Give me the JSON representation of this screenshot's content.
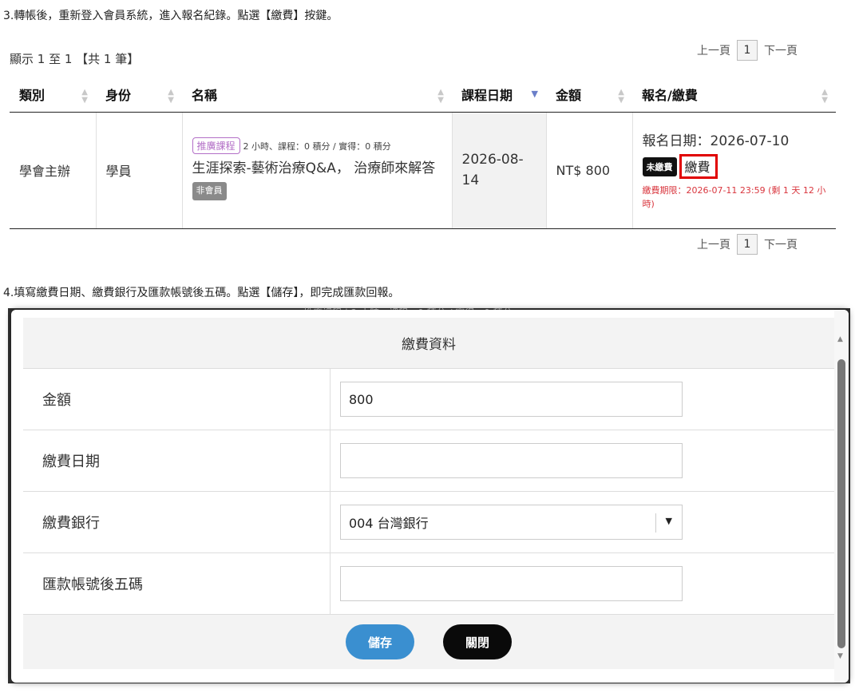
{
  "instructions": {
    "step3": "3.轉帳後，重新登入會員系統，進入報名紀錄。點選【繳費】按鍵。",
    "step4": "4.填寫繳費日期、繳費銀行及匯款帳號後五碼。點選【儲存】，即完成匯款回報。"
  },
  "list": {
    "summary": "顯示 1 至 1 【共 1 筆】",
    "pager": {
      "prev": "上一頁",
      "page": "1",
      "next": "下一頁"
    },
    "headers": {
      "category": "類別",
      "identity": "身份",
      "name": "名稱",
      "course_date": "課程日期",
      "amount": "金額",
      "reg_pay": "報名/繳費"
    },
    "row": {
      "category": "學會主辦",
      "identity": "學員",
      "promo_tag": "推廣課程",
      "course_meta": "2 小時、課程：0 積分 / 實得：0 積分",
      "course_name": "生涯探索-藝術治療Q&A， 治療師來解答",
      "nonmember_tag": "非會員",
      "course_date": "2026-08-14",
      "amount": "NT$ 800",
      "reg_date": "報名日期：2026-07-10",
      "unpaid_badge": "未繳費",
      "pay_link": "繳費",
      "deadline": "繳費期限：2026-07-11 23:59 (剩 1 天 12 小時)"
    }
  },
  "modal": {
    "peek_text": "推廣課程 | 2 小時、課程：0 積分 / 實得：0 積分",
    "title": "繳費資料",
    "fields": {
      "amount_label": "金額",
      "amount_value": "800",
      "date_label": "繳費日期",
      "date_value": "",
      "bank_label": "繳費銀行",
      "bank_value": "004 台灣銀行",
      "account_label": "匯款帳號後五碼",
      "account_value": ""
    },
    "buttons": {
      "save": "儲存",
      "close": "關閉"
    }
  },
  "colors": {
    "save_button": "#3a8fd0",
    "close_button": "#0a0a0a",
    "highlight_box": "#e00000",
    "deadline_text": "#d9363e",
    "promo_tag": "#b36fc7",
    "sort_active": "#6b7fc9"
  }
}
